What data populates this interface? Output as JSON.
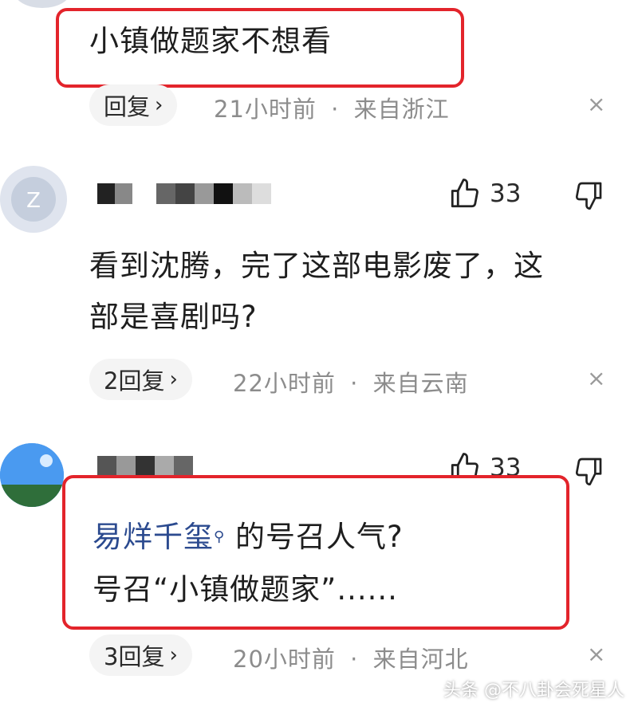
{
  "comment1": {
    "text": "小镇做题家不想看",
    "reply_label": "回复",
    "time": "21小时前",
    "location": "来自浙江"
  },
  "comment2": {
    "like_count": "33",
    "text_line1": "看到沈腾，完了这部电影废了，这",
    "text_line2": "部是喜剧吗?",
    "reply_label": "2回复",
    "time": "22小时前",
    "location": "来自云南"
  },
  "comment3": {
    "like_count": "33",
    "mention": "易烊千玺",
    "text_line1_rest": " 的号召人气?",
    "text_line2": "号召“小镇做题家”......",
    "reply_label": "3回复",
    "time": "20小时前",
    "location": "来自河北"
  },
  "separator": "·",
  "close_glyph": "×",
  "watermark": "头条 @不八卦会死星人",
  "colors": {
    "highlight_border": "#e3242b",
    "mention": "#2b4a8f"
  }
}
